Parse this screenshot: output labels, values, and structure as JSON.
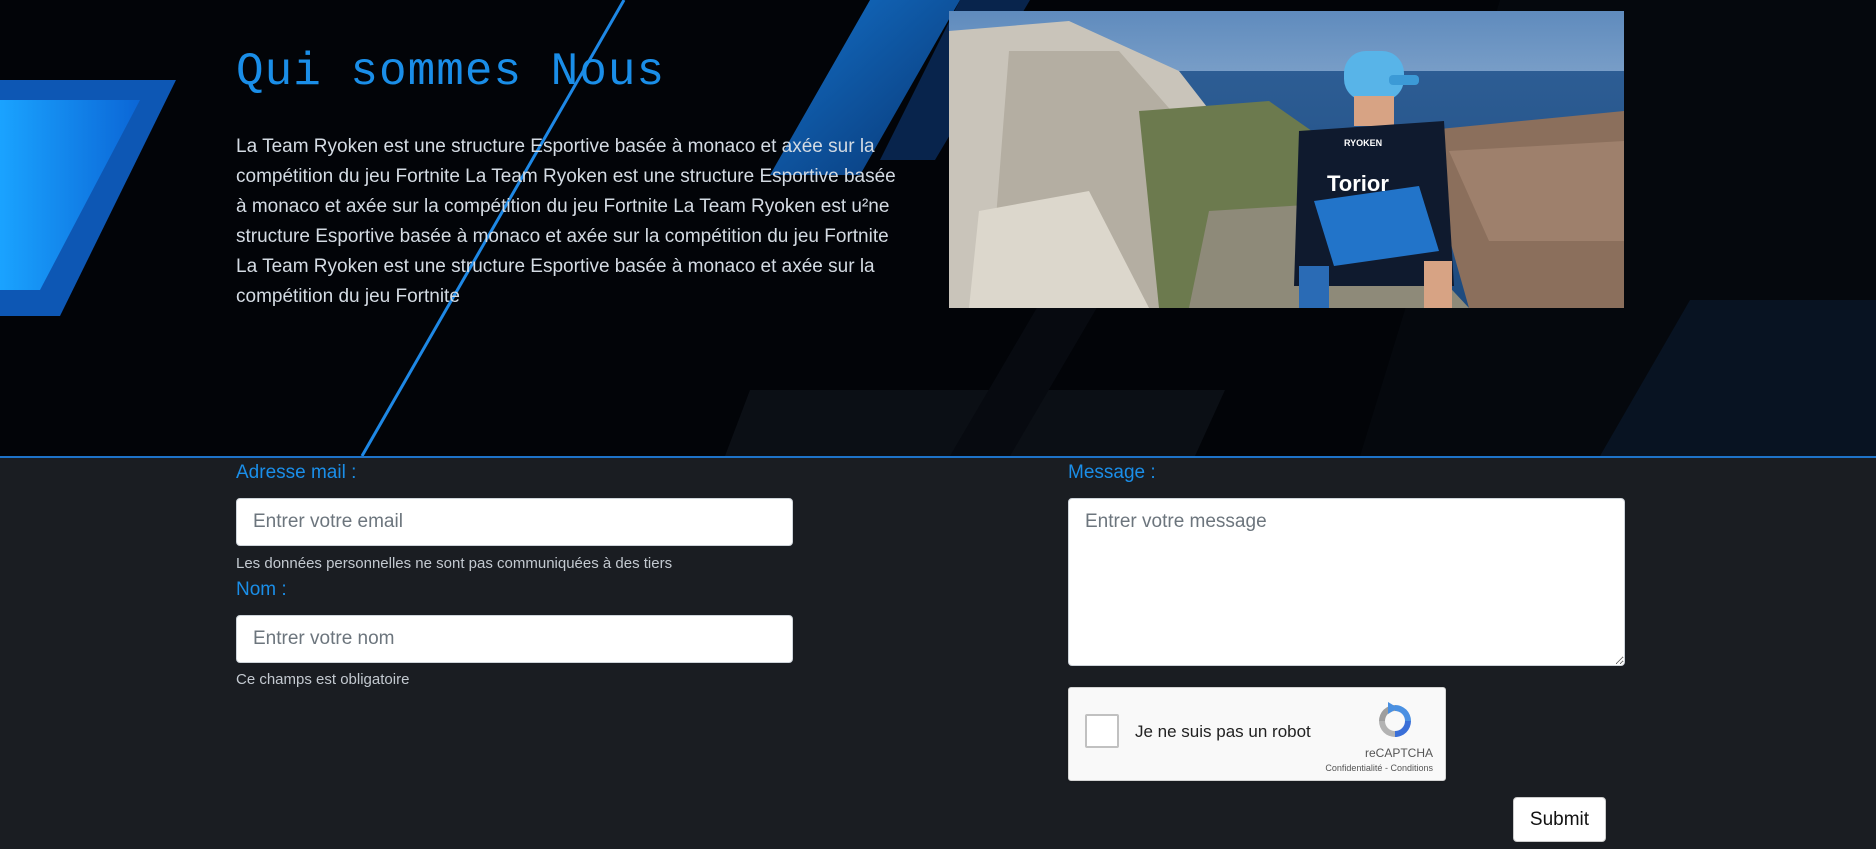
{
  "about": {
    "title": "Qui sommes Nous",
    "text": "La Team Ryoken est une structure Esportive basée à monaco et axée sur la compétition du jeu Fortnite La Team Ryoken est une structure Esportive basée à monaco et axée sur la compétition du jeu Fortnite La Team Ryoken est u²ne structure Esportive basée à monaco et axée sur la compétition du jeu Fortnite La Team Ryoken est une structure Esportive basée à monaco et axée sur la compétition du jeu Fortnite",
    "photo": {
      "jersey_brand": "RYOKEN",
      "jersey_name": "Torior"
    }
  },
  "form": {
    "email": {
      "label": "Adresse mail :",
      "value": "",
      "placeholder": "Entrer votre email",
      "hint": "Les données personnelles ne sont pas communiquées à des tiers"
    },
    "name": {
      "label": "Nom :",
      "value": "",
      "placeholder": "Entrer votre nom",
      "hint": "Ce champs est obligatoire"
    },
    "message": {
      "label": "Message :",
      "value": "",
      "placeholder": "Entrer votre message"
    },
    "captcha": {
      "label": "Je ne suis pas un robot",
      "brand": "reCAPTCHA",
      "privacy": "Confidentialité",
      "separator": "-",
      "terms": "Conditions",
      "icon": "recaptcha-logo-icon"
    },
    "submit_label": "Submit"
  },
  "colors": {
    "accent": "#1a8ee8",
    "page_bg": "#1a1d22",
    "hero_bg": "#020408"
  }
}
